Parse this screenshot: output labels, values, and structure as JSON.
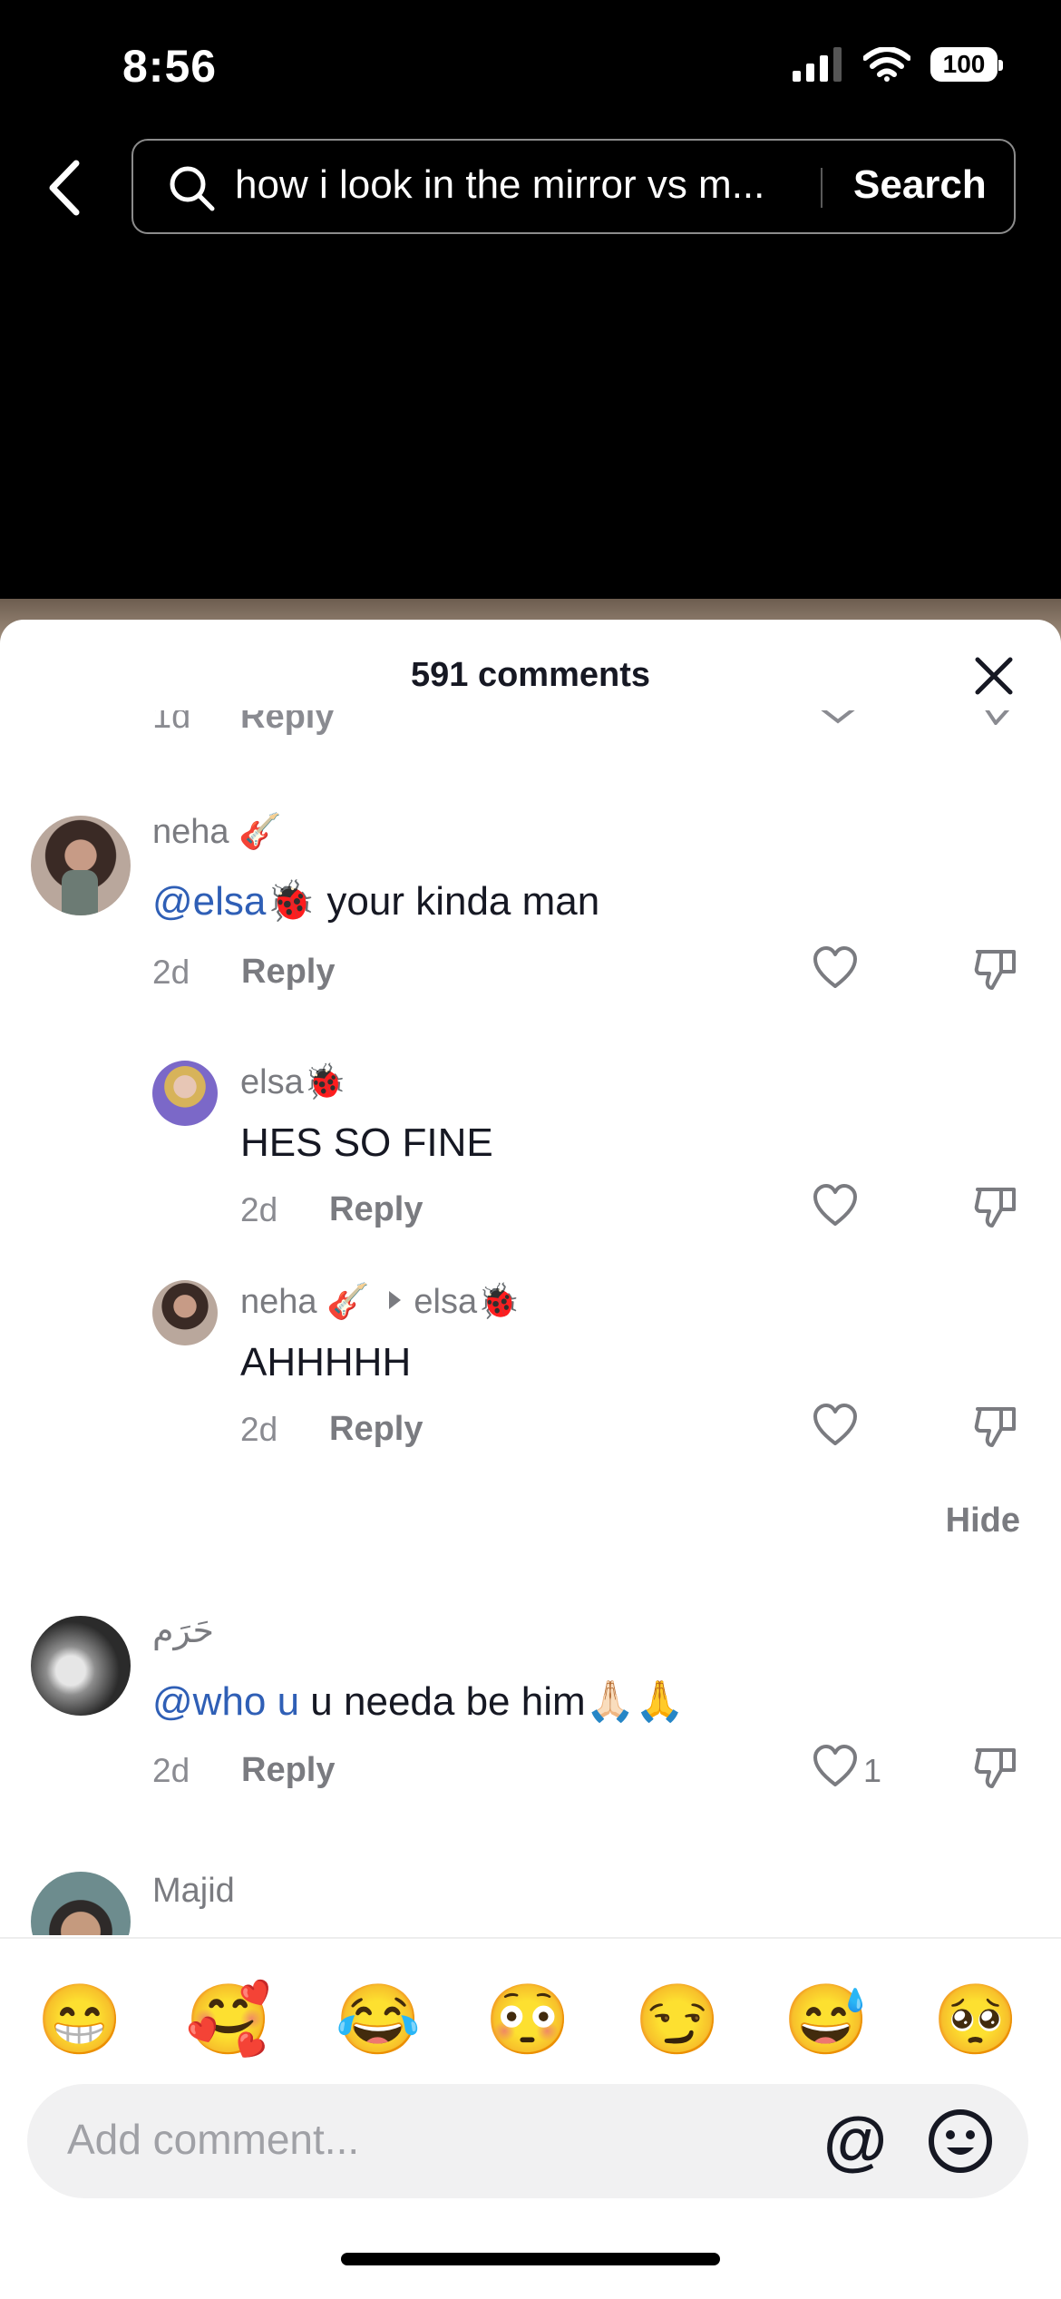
{
  "status": {
    "time": "8:56",
    "battery": "100"
  },
  "search": {
    "query": "how i look in the mirror vs m...",
    "button": "Search"
  },
  "sheet": {
    "title": "591 comments"
  },
  "partial_row": {
    "date": "1d",
    "reply": "Reply"
  },
  "comments": [
    {
      "username": "neha 🎸",
      "mention": "@elsa🐞",
      "text": " your kinda man",
      "date": "2d",
      "reply": "Reply"
    },
    {
      "username": "elsa🐞",
      "text": "HES SO FINE",
      "date": "2d",
      "reply": "Reply"
    },
    {
      "username": "neha 🎸",
      "reply_to": "elsa🐞",
      "text": "AHHHHH",
      "date": "2d",
      "reply": "Reply"
    },
    {
      "username": "حَرَم",
      "mention": "@who u",
      "text": " u needa be him🙏🏻🙏",
      "date": "2d",
      "reply": "Reply",
      "likes": "1"
    },
    {
      "username": "Majid"
    }
  ],
  "hide_label": "Hide",
  "quick_emojis": [
    "😁",
    "🥰",
    "😂",
    "😳",
    "😏",
    "😅",
    "🥺"
  ],
  "composer": {
    "placeholder": "Add comment...",
    "at": "@"
  },
  "colors": {
    "mention": "#2f5fb6",
    "meta": "#8a8b91",
    "sheet_bg": "#ffffff"
  }
}
